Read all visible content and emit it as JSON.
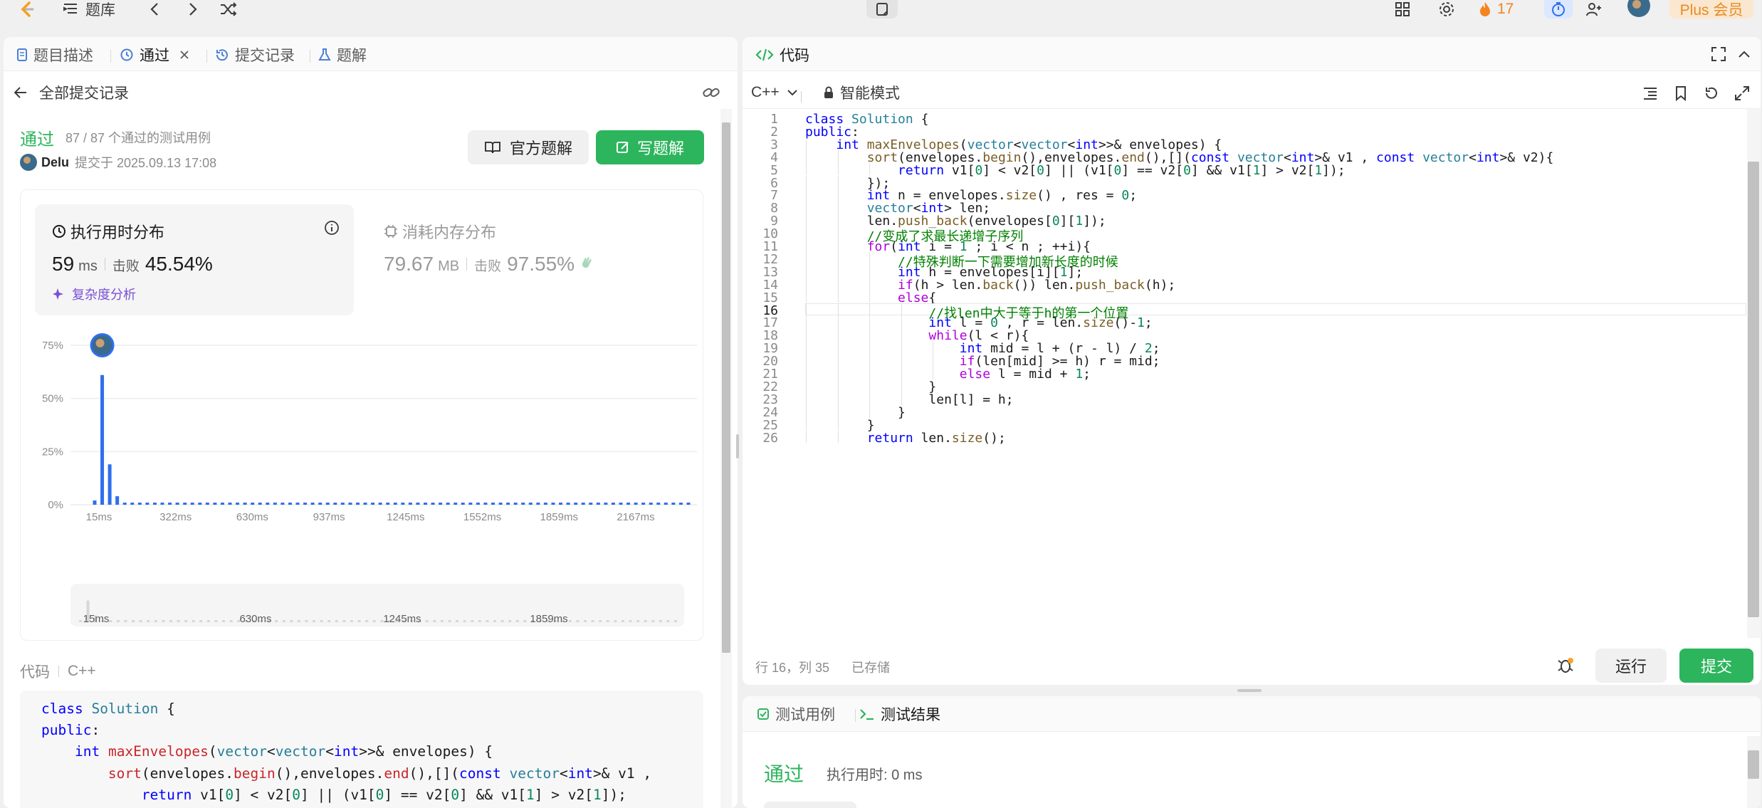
{
  "topbar": {
    "problem_bank": "题库",
    "streak_count": "17",
    "plus_label": "Plus 会员"
  },
  "left": {
    "tabs": [
      {
        "label": "题目描述"
      },
      {
        "label": "通过"
      },
      {
        "label": "提交记录"
      },
      {
        "label": "题解"
      }
    ],
    "back_label": "全部提交记录",
    "status": "通过",
    "testcases": "87 / 87 个通过的测试用例",
    "user": "Delu",
    "submitted_at": "提交于 2025.09.13 17:08",
    "official_solution_btn": "官方题解",
    "write_solution_btn": "写题解",
    "runtime": {
      "title": "执行用时分布",
      "value": "59",
      "unit": "ms",
      "beats_label": "击败",
      "beats": "45.54%",
      "complexity": "复杂度分析"
    },
    "memory": {
      "title": "消耗内存分布",
      "value": "79.67",
      "unit": "MB",
      "beats_label": "击败",
      "beats": "97.55%"
    },
    "code_label": "代码",
    "lang_label": "C++",
    "read_code": [
      "class Solution {",
      "public:",
      "    int maxEnvelopes(vector<vector<int>>& envelopes) {",
      "        sort(envelopes.begin(),envelopes.end(),[](const vector<int>& v1 ,",
      "            return v1[0] < v2[0] || (v1[0] == v2[0] && v1[1] > v2[1]);",
      "        });",
      "        int n = envelopes.size() , res = 0;"
    ]
  },
  "chart_data": {
    "type": "bar",
    "title": "执行用时分布",
    "xlabel": "",
    "ylabel": "",
    "ylim": [
      0,
      75
    ],
    "yticks": [
      "75%",
      "50%",
      "25%",
      "0%"
    ],
    "xticks": [
      "15ms",
      "322ms",
      "630ms",
      "937ms",
      "1245ms",
      "1552ms",
      "1859ms",
      "2167ms"
    ],
    "values": [
      2,
      61,
      19,
      4,
      1,
      1,
      1,
      1,
      1,
      1,
      1,
      1,
      1,
      1,
      1,
      1,
      1,
      1,
      1,
      1,
      1,
      1,
      1,
      1,
      1,
      1,
      1,
      1,
      1,
      1,
      1,
      1,
      1,
      1,
      1,
      1,
      1,
      1,
      1,
      1,
      1,
      1,
      1,
      1,
      1,
      1,
      1,
      1,
      1,
      1,
      1,
      1,
      1,
      1,
      1,
      1,
      1,
      1,
      1,
      1,
      1,
      1,
      1,
      1,
      1,
      1,
      1,
      1,
      1,
      1,
      1,
      1,
      1,
      1,
      1,
      1,
      1,
      1,
      1,
      1
    ],
    "highlight_index": 1,
    "bar_color": "#2f6fed",
    "minimap_ticks": [
      "15ms",
      "630ms",
      "1245ms",
      "1859ms"
    ],
    "grid": true
  },
  "editor": {
    "title": "代码",
    "lang": "C++",
    "mode": "智能模式",
    "status_pos": "行 16，列 35",
    "saved": "已存储",
    "run_btn": "运行",
    "submit_btn": "提交",
    "current_line": 16,
    "lines": [
      "class Solution {",
      "public:",
      "    int maxEnvelopes(vector<vector<int>>& envelopes) {",
      "        sort(envelopes.begin(),envelopes.end(),[](const vector<int>& v1 , const vector<int>& v2){",
      "            return v1[0] < v2[0] || (v1[0] == v2[0] && v1[1] > v2[1]);",
      "        });",
      "        int n = envelopes.size() , res = 0;",
      "        vector<int> len;",
      "        len.push_back(envelopes[0][1]);",
      "        //变成了求最长递增子序列",
      "        for(int i = 1 ; i < n ; ++i){",
      "            //特殊判断一下需要增加新长度的时候",
      "            int h = envelopes[i][1];",
      "            if(h > len.back()) len.push_back(h);",
      "            else{",
      "                //找len中大于等于h的第一个位置",
      "                int l = 0 , r = len.size()-1;",
      "                while(l < r){",
      "                    int mid = l + (r - l) / 2;",
      "                    if(len[mid] >= h) r = mid;",
      "                    else l = mid + 1;",
      "                }",
      "                len[l] = h;",
      "            }",
      "        }",
      "        return len.size();"
    ]
  },
  "tests": {
    "tab_cases": "测试用例",
    "tab_result": "测试结果",
    "status": "通过",
    "runtime": "执行用时: 0 ms"
  },
  "colors": {
    "green": "#2db55d",
    "accent_blue": "#2f6fed",
    "streak_orange": "#f5841f",
    "plus_bg": "#fbe7cf"
  }
}
